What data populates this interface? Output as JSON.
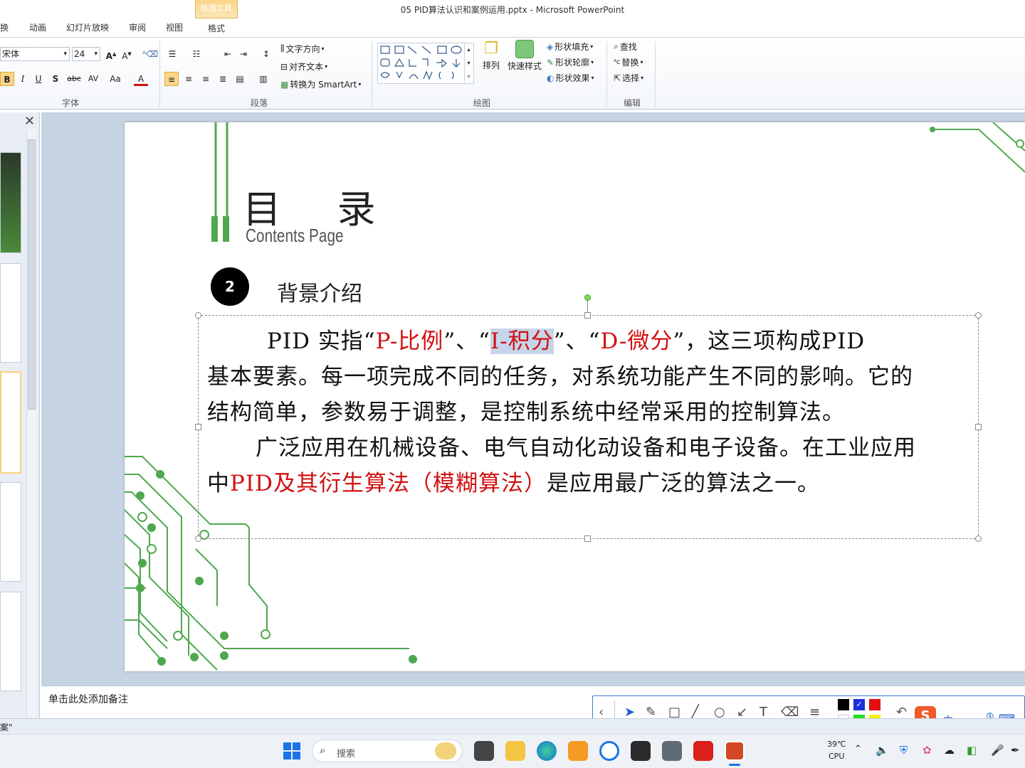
{
  "window": {
    "title": "05 PID算法认识和案例运用.pptx  -  Microsoft PowerPoint",
    "context_tab_group": "绘图工具"
  },
  "tabs": [
    "换",
    "动画",
    "幻灯片放映",
    "审阅",
    "视图",
    "格式"
  ],
  "ribbon": {
    "font": {
      "name": "宋体",
      "size": "24",
      "group_label": "字体",
      "bold": "B",
      "italic": "I",
      "underline": "U",
      "shadow": "S",
      "strike": "abc",
      "spacing": "AV",
      "case": "Aa",
      "color": "A"
    },
    "paragraph": {
      "group_label": "段落",
      "text_direction": "文字方向",
      "align_text": "对齐文本",
      "smartart": "转换为 SmartArt"
    },
    "drawing": {
      "group_label": "绘图",
      "arrange": "排列",
      "quick_styles": "快速样式",
      "shape_fill": "形状填充",
      "shape_outline": "形状轮廓",
      "shape_effects": "形状效果"
    },
    "editing": {
      "group_label": "编辑",
      "find": "查找",
      "replace": "替换",
      "select": "选择"
    }
  },
  "slide": {
    "title": "目    录",
    "subtitle": "Contents Page",
    "section_number": "2",
    "section_title": "背景介绍",
    "p1_segments": [
      {
        "text": "PID 实指“",
        "red": false
      },
      {
        "text": "P-比例",
        "red": true
      },
      {
        "text": "”、“",
        "red": false
      },
      {
        "text": "I-积分",
        "red": true,
        "selected": true
      },
      {
        "text": "”、“",
        "red": false
      },
      {
        "text": "D-微分",
        "red": true
      },
      {
        "text": "”，这三项构成PID",
        "red": false
      }
    ],
    "p1_line2": "基本要素。每一项完成不同的任务，对系统功能产生不同的影响。它的",
    "p1_line3": "结构简单，参数易于调整，是控制系统中经常采用的控制算法。",
    "p2_line1": "广泛应用在机械设备、电气自动化动设备和电子设备。在工业应用",
    "p2_line2_prefix": "中",
    "p2_line2_red": "PID及其衍生算法（模糊算法）",
    "p2_line2_suffix": "是应用最广泛的算法之一。"
  },
  "notes_placeholder": "单击此处添加备注",
  "status_text": "案\"",
  "taskbar": {
    "search_placeholder": "搜索",
    "temperature": "39℃",
    "cpu_label": "CPU",
    "ime": "中"
  },
  "colors": {
    "accent_red": "#d11010",
    "circuit_green": "#4fa84f",
    "selection": "#c5d5ea"
  }
}
